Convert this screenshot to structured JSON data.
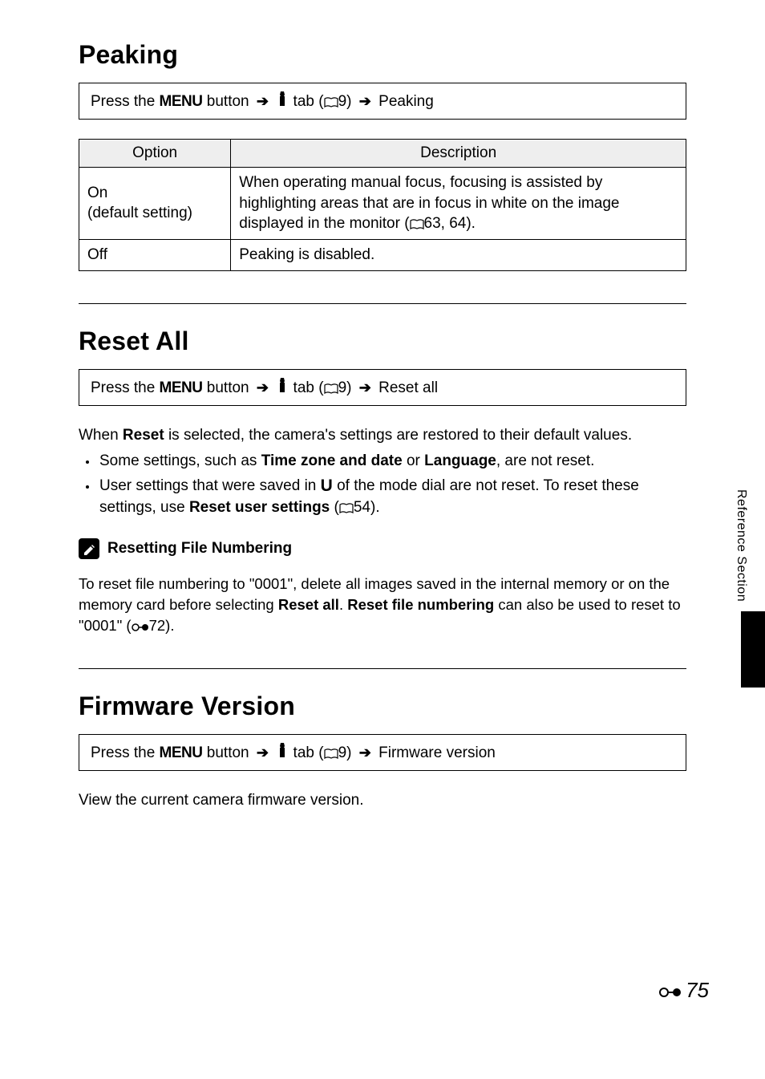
{
  "section1": {
    "title": "Peaking",
    "instruction": {
      "press": "Press the",
      "menu": "MENU",
      "button": "button",
      "tab": "tab (",
      "tab_page_ref": "9)",
      "item_label": "Peaking"
    },
    "table": {
      "col_option": "Option",
      "col_desc": "Description",
      "rows": [
        {
          "option_l1": "On",
          "option_l2": "(default setting)",
          "desc_before": "When operating manual focus, focusing is assisted by highlighting areas that are in focus in white on the image displayed in the monitor (",
          "desc_ref": "63, 64).",
          "desc_after": ""
        },
        {
          "option_l1": "Off",
          "option_l2": "",
          "desc_before": "Peaking is disabled.",
          "desc_ref": "",
          "desc_after": ""
        }
      ]
    }
  },
  "section2": {
    "title": "Reset All",
    "instruction": {
      "press": "Press the",
      "menu": "MENU",
      "button": "button",
      "tab": "tab (",
      "tab_page_ref": "9)",
      "item_label": "Reset all"
    },
    "body_before": "When ",
    "body_bold": "Reset",
    "body_after": " is selected, the camera's settings are restored to their default values.",
    "bullets": [
      {
        "t1": "Some settings, such as ",
        "b1": "Time zone and date",
        "t2": " or ",
        "b2": "Language",
        "t3": ", are not reset."
      },
      {
        "t1": "User settings that were saved in ",
        "uglyph": "U",
        "t2": " of the mode dial are not reset. To reset these settings, use ",
        "b1": "Reset user settings",
        "t3": " (",
        "ref": "54).",
        "t4": ""
      }
    ],
    "note": {
      "title": "Resetting File Numbering",
      "body_t1": "To reset file numbering to \"0001\", delete all images saved in the internal memory or on the memory card before selecting ",
      "body_b1": "Reset all",
      "body_t2": ". ",
      "body_b2": "Reset file numbering",
      "body_t3": " can also be used to reset to \"0001\" (",
      "body_ref": "72).",
      "body_t4": ""
    }
  },
  "section3": {
    "title": "Firmware Version",
    "instruction": {
      "press": "Press the",
      "menu": "MENU",
      "button": "button",
      "tab": "tab (",
      "tab_page_ref": "9)",
      "item_label": "Firmware version"
    },
    "body": "View the current camera firmware version."
  },
  "side_label": "Reference Section",
  "page_number": "75"
}
